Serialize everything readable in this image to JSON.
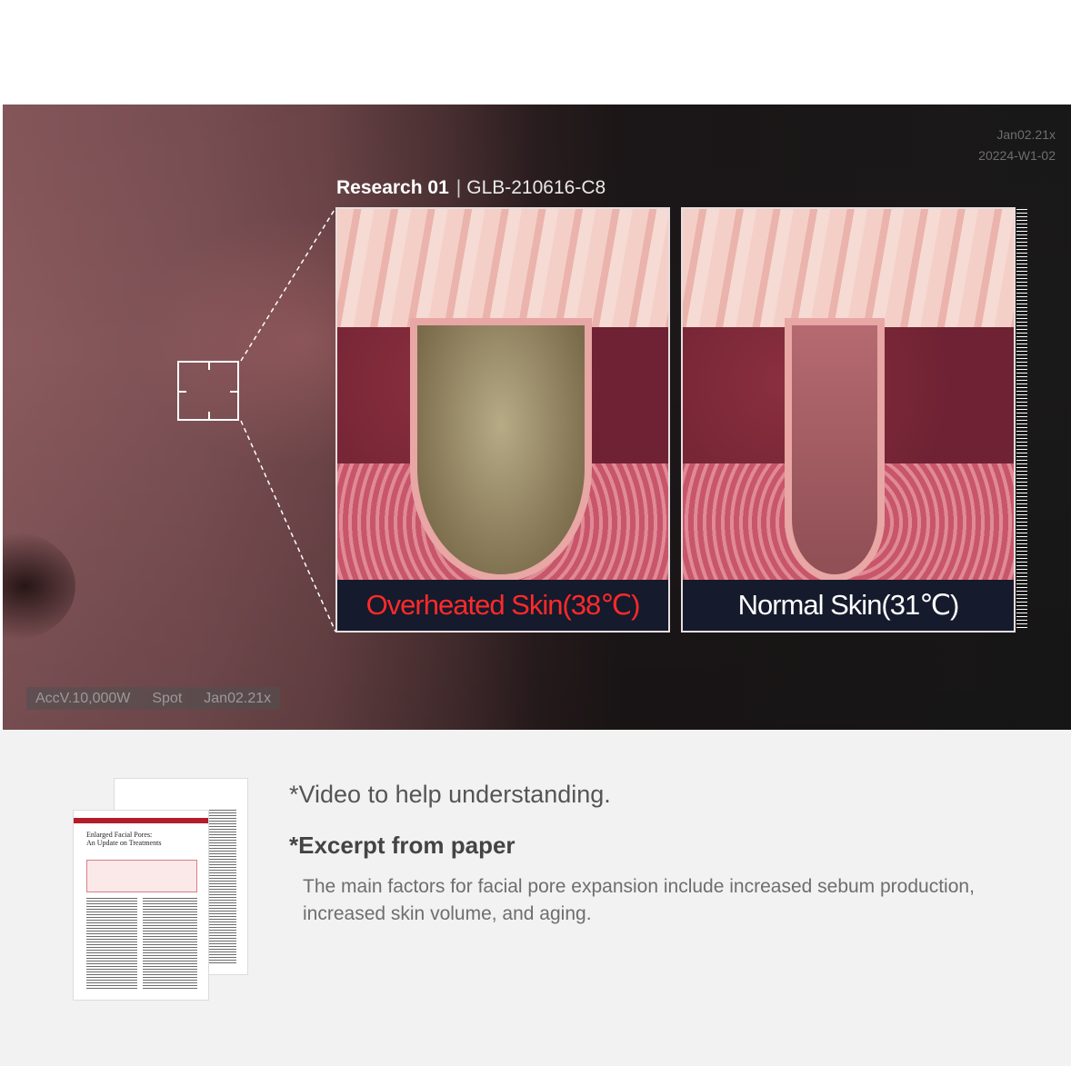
{
  "hero": {
    "meta_top_line1": "Jan02.21x",
    "meta_top_line2": "20224-W1-02",
    "research_label": "Research 01",
    "research_separator": "|",
    "research_code": "GLB-210616-C8",
    "panels": [
      {
        "caption": "Overheated Skin(38℃)",
        "caption_color": "#ff2a2a"
      },
      {
        "caption": "Normal Skin(31℃)",
        "caption_color": "#ffffff"
      }
    ],
    "bottom_meta": [
      "AccV.10,000W",
      "Spot",
      "Jan02.21x"
    ]
  },
  "lower": {
    "video_note": "*Video to help understanding.",
    "excerpt_title": "*Excerpt from paper",
    "excerpt_body": "The main factors for facial pore expansion include increased sebum production, increased skin volume, and aging.",
    "paper_thumbnail": {
      "front_title_line1": "Enlarged Facial Pores:",
      "front_title_line2": "An Update on Treatments"
    }
  }
}
